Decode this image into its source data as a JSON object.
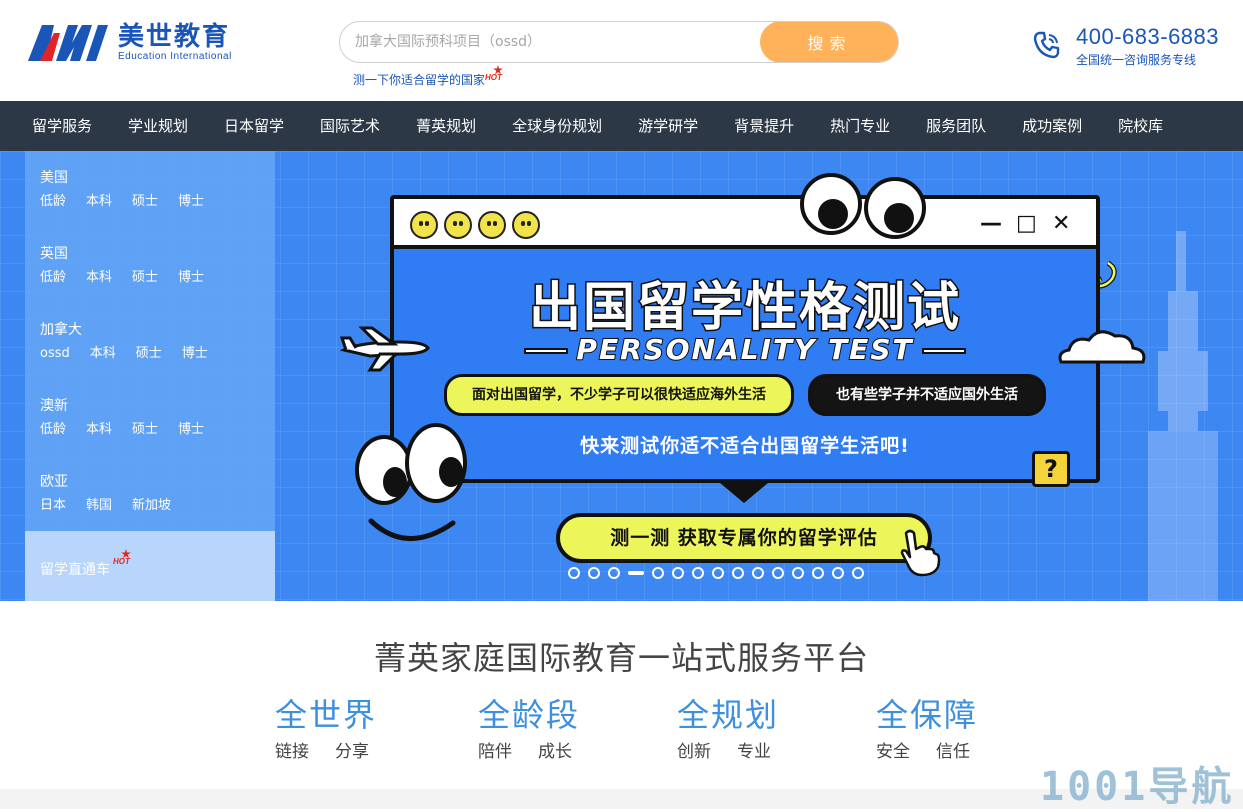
{
  "header": {
    "logo": {
      "cn": "美世教育",
      "en": "Education  International"
    },
    "search": {
      "placeholder": "加拿大国际预科项目（ossd）",
      "button": "搜索"
    },
    "quiz_link": "测一下你适合留学的国家",
    "hot_label": "HOT",
    "hotline": {
      "number": "400-683-6883",
      "label": "全国统一咨询服务专线"
    }
  },
  "nav": {
    "items": [
      "留学服务",
      "学业规划",
      "日本留学",
      "国际艺术",
      "菁英规划",
      "全球身份规划",
      "游学研学",
      "背景提升",
      "热门专业",
      "服务团队",
      "成功案例",
      "院校库"
    ]
  },
  "region_menu": {
    "regions": [
      {
        "title": "美国",
        "links": [
          "低龄",
          "本科",
          "硕士",
          "博士"
        ]
      },
      {
        "title": "英国",
        "links": [
          "低龄",
          "本科",
          "硕士",
          "博士"
        ]
      },
      {
        "title": "加拿大",
        "links": [
          "ossd",
          "本科",
          "硕士",
          "博士"
        ]
      },
      {
        "title": "澳新",
        "links": [
          "低龄",
          "本科",
          "硕士",
          "博士"
        ]
      },
      {
        "title": "欧亚",
        "links": [
          "日本",
          "韩国",
          "新加坡"
        ]
      }
    ],
    "direct_train": "留学直通车"
  },
  "banner": {
    "headline": "出国留学性格测试",
    "subheadline": "PERSONALITY TEST",
    "bubble_left": "面对出国留学，不少学子可以很快适应海外生活",
    "bubble_right": "也有些学子并不适应国外生活",
    "prompt": "快来测试你适不适合出国留学生活吧!",
    "qmark": "?",
    "cta": "测一测  获取专属你的留学评估",
    "window_controls": [
      "—",
      "□",
      "✕"
    ],
    "slide_count": 15,
    "active_slide": 3
  },
  "platform": {
    "title": "菁英家庭国际教育一站式服务平台",
    "features": [
      {
        "title": "全世界",
        "subs": [
          "链接",
          "分享"
        ]
      },
      {
        "title": "全龄段",
        "subs": [
          "陪伴",
          "成长"
        ]
      },
      {
        "title": "全规划",
        "subs": [
          "创新",
          "专业"
        ]
      },
      {
        "title": "全保障",
        "subs": [
          "安全",
          "信任"
        ]
      }
    ]
  },
  "watermark": "1001导航",
  "colors": {
    "brand": "#1a55b8",
    "accent": "#ffb259",
    "nav_bg": "#2d3846",
    "banner_bg": "#3c87f2",
    "feature_title": "#3d8fe0"
  }
}
